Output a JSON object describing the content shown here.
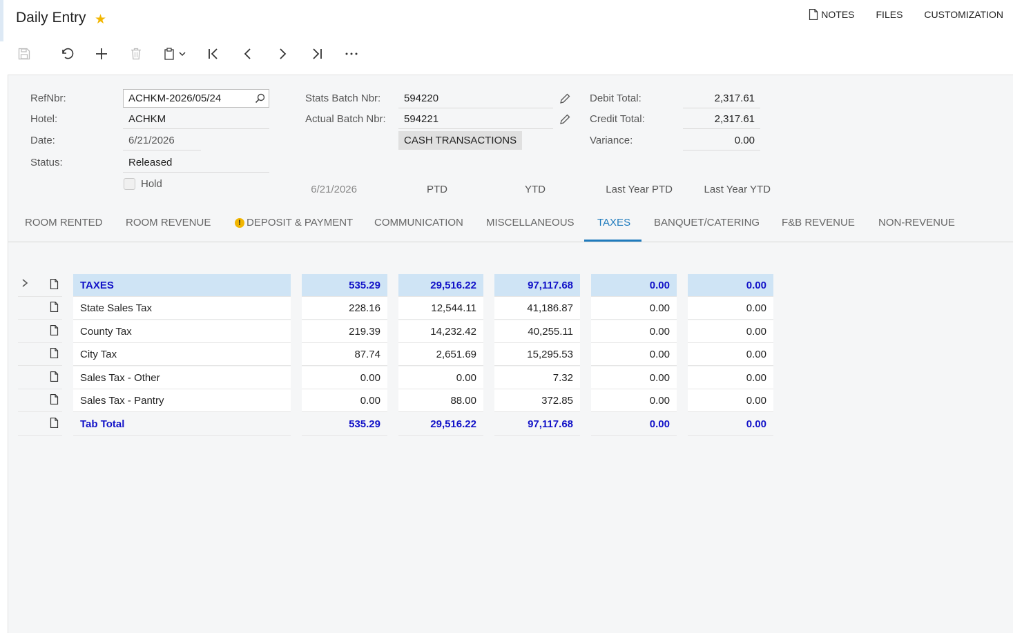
{
  "header": {
    "title": "Daily Entry",
    "links": {
      "notes": "NOTES",
      "files": "FILES",
      "customization": "CUSTOMIZATION"
    }
  },
  "toolbar": [
    "save-icon",
    "undo-icon",
    "add-icon",
    "delete-icon",
    "clipboard-icon",
    "first-icon",
    "prev-icon",
    "next-icon",
    "last-icon",
    "more-icon"
  ],
  "form": {
    "refnbr_label": "RefNbr:",
    "refnbr_value": "ACHKM-2026/05/24",
    "hotel_label": "Hotel:",
    "hotel_value": "ACHKM",
    "date_label": "Date:",
    "date_value": "6/21/2026",
    "status_label": "Status:",
    "status_value": "Released",
    "hold_label": "Hold",
    "stats_batch_label": "Stats Batch Nbr:",
    "stats_batch_value": "594220",
    "actual_batch_label": "Actual Batch Nbr:",
    "actual_batch_value": "594221",
    "cash_button": "CASH TRANSACTIONS",
    "debit_label": "Debit Total:",
    "debit_value": "2,317.61",
    "credit_label": "Credit Total:",
    "credit_value": "2,317.61",
    "variance_label": "Variance:",
    "variance_value": "0.00"
  },
  "tabs": [
    {
      "label": "ROOM RENTED"
    },
    {
      "label": "ROOM REVENUE"
    },
    {
      "label": "DEPOSIT & PAYMENT",
      "warning": "!"
    },
    {
      "label": "COMMUNICATION"
    },
    {
      "label": "MISCELLANEOUS"
    },
    {
      "label": "TAXES",
      "active": true
    },
    {
      "label": "BANQUET/CATERING"
    },
    {
      "label": "F&B REVENUE"
    },
    {
      "label": "NON-REVENUE"
    }
  ],
  "grid": {
    "columns": [
      "6/21/2026",
      "PTD",
      "YTD",
      "Last Year PTD",
      "Last Year YTD"
    ],
    "rows": [
      {
        "name": "TAXES",
        "values": [
          "535.29",
          "29,516.22",
          "97,117.68",
          "0.00",
          "0.00"
        ]
      },
      {
        "name": "State Sales Tax",
        "values": [
          "228.16",
          "12,544.11",
          "41,186.87",
          "0.00",
          "0.00"
        ]
      },
      {
        "name": "County Tax",
        "values": [
          "219.39",
          "14,232.42",
          "40,255.11",
          "0.00",
          "0.00"
        ]
      },
      {
        "name": "City Tax",
        "values": [
          "87.74",
          "2,651.69",
          "15,295.53",
          "0.00",
          "0.00"
        ]
      },
      {
        "name": "Sales Tax - Other",
        "values": [
          "0.00",
          "0.00",
          "7.32",
          "0.00",
          "0.00"
        ]
      },
      {
        "name": "Sales Tax - Pantry",
        "values": [
          "0.00",
          "88.00",
          "372.85",
          "0.00",
          "0.00"
        ]
      },
      {
        "name": "Tab Total",
        "values": [
          "535.29",
          "29,516.22",
          "97,117.68",
          "0.00",
          "0.00"
        ]
      }
    ]
  }
}
